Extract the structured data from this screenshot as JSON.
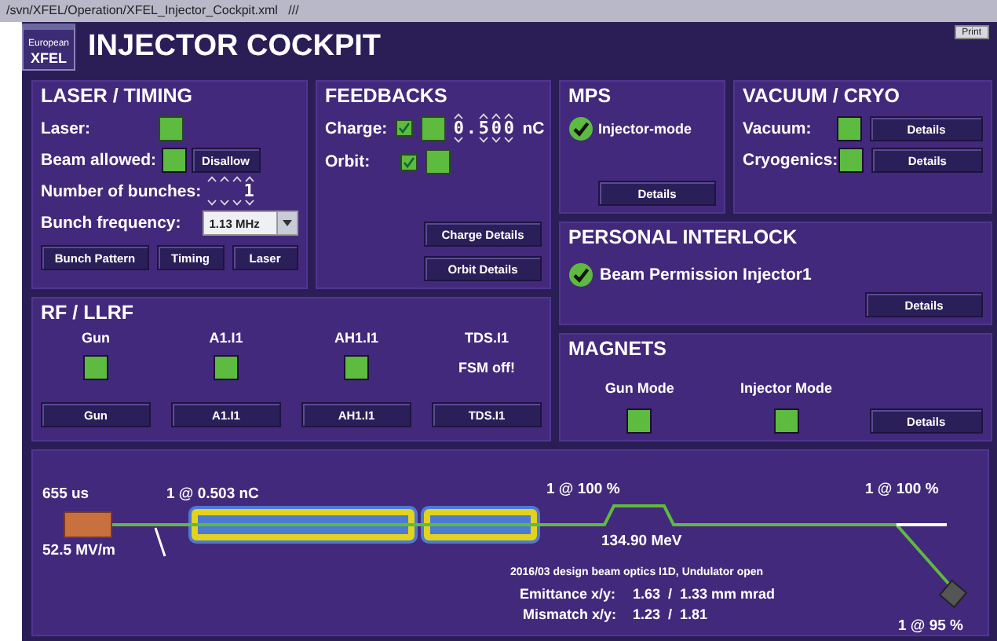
{
  "path_bar": "/svn/XFEL/Operation/XFEL_Injector_Cockpit.xml   ///",
  "print_button": "Print",
  "logo": {
    "small": "European",
    "big": "XFEL"
  },
  "title": "INJECTOR COCKPIT",
  "laser_timing": {
    "title": "LASER / TIMING",
    "laser": {
      "label": "Laser:",
      "ok": true
    },
    "beam_allowed": {
      "label": "Beam allowed:",
      "ok": true,
      "button": "Disallow"
    },
    "bunches": {
      "label": "Number of bunches:",
      "value": "1"
    },
    "frequency": {
      "label": "Bunch frequency:",
      "value": "1.13 MHz"
    },
    "buttons": [
      "Bunch Pattern",
      "Timing",
      "Laser"
    ]
  },
  "feedbacks": {
    "title": "FEEDBACKS",
    "rows": [
      {
        "label": "Charge:",
        "checked": true,
        "ok": true,
        "value": "0.500",
        "unit": "nC"
      },
      {
        "label": "Orbit:",
        "checked": true,
        "ok": true
      }
    ],
    "buttons": [
      "Charge Details",
      "Orbit Details"
    ]
  },
  "mps": {
    "title": "MPS",
    "status": "Injector-mode",
    "ok": true,
    "button": "Details"
  },
  "vacuum_cryo": {
    "title": "VACUUM / CRYO",
    "rows": [
      {
        "label": "Vacuum:",
        "ok": true,
        "button": "Details"
      },
      {
        "label": "Cryogenics:",
        "ok": true,
        "button": "Details"
      }
    ]
  },
  "personal_interlock": {
    "title": "PERSONAL INTERLOCK",
    "status": "Beam Permission Injector1",
    "ok": true,
    "button": "Details"
  },
  "rf_llrf": {
    "title": "RF / LLRF",
    "stations": [
      {
        "name": "Gun",
        "kind": "indicator",
        "ok": true,
        "button": "Gun"
      },
      {
        "name": "A1.I1",
        "kind": "indicator",
        "ok": true,
        "button": "A1.I1"
      },
      {
        "name": "AH1.I1",
        "kind": "indicator",
        "ok": true,
        "button": "AH1.I1"
      },
      {
        "name": "TDS.I1",
        "kind": "message",
        "message": "FSM off!",
        "button": "TDS.I1"
      }
    ]
  },
  "magnets": {
    "title": "MAGNETS",
    "modes": [
      {
        "label": "Gun Mode",
        "ok": true
      },
      {
        "label": "Injector Mode",
        "ok": true
      }
    ],
    "button": "Details"
  },
  "beamline": {
    "gun_time": "655 us",
    "gun_gradient": "52.5 MV/m",
    "charge": "1 @ 0.503 nC",
    "transmission_1": "1 @ 100 %",
    "energy": "134.90 MeV",
    "transmission_2": "1 @ 100 %",
    "transmission_dump": "1 @ 95 %",
    "optics": "2016/03 design beam optics I1D, Undulator open",
    "emittance_label": "Emittance x/y:",
    "emittance": "1.63  /  1.33 mm mrad",
    "mismatch_label": "Mismatch x/y:",
    "mismatch": "1.23  /  1.81"
  }
}
